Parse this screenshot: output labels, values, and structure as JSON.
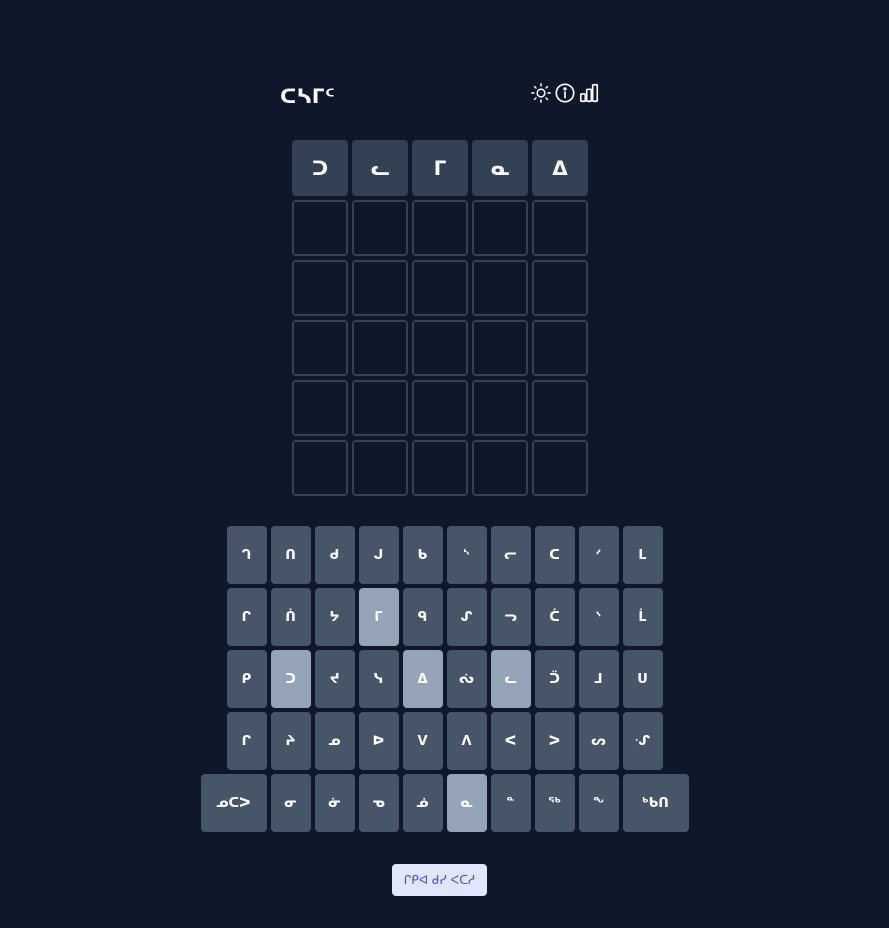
{
  "header": {
    "title": "ᑕᓴᒥᑦ",
    "icons": [
      "sun-icon",
      "info-icon",
      "chart-bar-icon"
    ]
  },
  "board": {
    "rows": [
      [
        "ᑐ",
        "ᓚ",
        "ᒥ",
        "ᓇ",
        "ᐃ"
      ],
      [
        "",
        "",
        "",
        "",
        ""
      ],
      [
        "",
        "",
        "",
        "",
        ""
      ],
      [
        "",
        "",
        "",
        "",
        ""
      ],
      [
        "",
        "",
        "",
        "",
        ""
      ],
      [
        "",
        "",
        "",
        "",
        ""
      ]
    ]
  },
  "keyboard": {
    "rows": [
      [
        {
          "label": "ᒉ",
          "state": "default"
        },
        {
          "label": "ᑎ",
          "state": "default"
        },
        {
          "label": "ᑯ",
          "state": "default"
        },
        {
          "label": "ᒍ",
          "state": "default"
        },
        {
          "label": "ᑲ",
          "state": "default"
        },
        {
          "label": "ᔅ",
          "state": "default"
        },
        {
          "label": "ᓕ",
          "state": "default"
        },
        {
          "label": "ᑕ",
          "state": "default"
        },
        {
          "label": "ᐟ",
          "state": "default"
        },
        {
          "label": "ᒪ",
          "state": "default"
        }
      ],
      [
        {
          "label": "ᒋ",
          "state": "default"
        },
        {
          "label": "ᑏ",
          "state": "default"
        },
        {
          "label": "ᔭ",
          "state": "default"
        },
        {
          "label": "ᒥ",
          "state": "present"
        },
        {
          "label": "ᑫ",
          "state": "default"
        },
        {
          "label": "ᔑ",
          "state": "default"
        },
        {
          "label": "ᓓ",
          "state": "default"
        },
        {
          "label": "ᑖ",
          "state": "default"
        },
        {
          "label": "ᐠ",
          "state": "default"
        },
        {
          "label": "ᒫ",
          "state": "default"
        }
      ],
      [
        {
          "label": "ᑭ",
          "state": "default"
        },
        {
          "label": "ᑐ",
          "state": "present"
        },
        {
          "label": "ᔪ",
          "state": "default"
        },
        {
          "label": "ᓭ",
          "state": "default"
        },
        {
          "label": "ᐃ",
          "state": "present"
        },
        {
          "label": "ᔔ",
          "state": "default"
        },
        {
          "label": "ᓚ",
          "state": "present"
        },
        {
          "label": "ᑒ",
          "state": "default"
        },
        {
          "label": "ᒧ",
          "state": "default"
        },
        {
          "label": "ᑌ",
          "state": "default"
        }
      ],
      [
        {
          "label": "ᒋ",
          "state": "default"
        },
        {
          "label": "ᔨ",
          "state": "default"
        },
        {
          "label": "ᓄ",
          "state": "default"
        },
        {
          "label": "ᐅ",
          "state": "default"
        },
        {
          "label": "ᐯ",
          "state": "default"
        },
        {
          "label": "ᐱ",
          "state": "default"
        },
        {
          "label": "ᐸ",
          "state": "default"
        },
        {
          "label": "ᐳ",
          "state": "default"
        },
        {
          "label": "ᔕ",
          "state": "default"
        },
        {
          "label": "ᔙ",
          "state": "default"
        }
      ],
      [
        {
          "label": "ᓄᑕᐳ",
          "state": "default",
          "wide": true
        },
        {
          "label": "ᓂ",
          "state": "default"
        },
        {
          "label": "ᓃ",
          "state": "default"
        },
        {
          "label": "ᓀ",
          "state": "default"
        },
        {
          "label": "ᓅ",
          "state": "default"
        },
        {
          "label": "ᓇ",
          "state": "present"
        },
        {
          "label": "ᓐ",
          "state": "default"
        },
        {
          "label": "ᖅ",
          "state": "default"
        },
        {
          "label": "ᖕ",
          "state": "default"
        },
        {
          "label": "ᒃᑲᑎ",
          "state": "default",
          "wide": true
        }
      ]
    ]
  },
  "reveal_button": {
    "label": "ᒋᑭᐊ ᑯᓯ ᐸᑕᓱ"
  },
  "colors": {
    "background": "#0f172a",
    "tile_border": "#334155",
    "tile_filled": "#334155",
    "key_default": "#475569",
    "key_present": "#94a3b8",
    "button_bg": "#e0e7ff",
    "button_text": "#4f46e5"
  }
}
